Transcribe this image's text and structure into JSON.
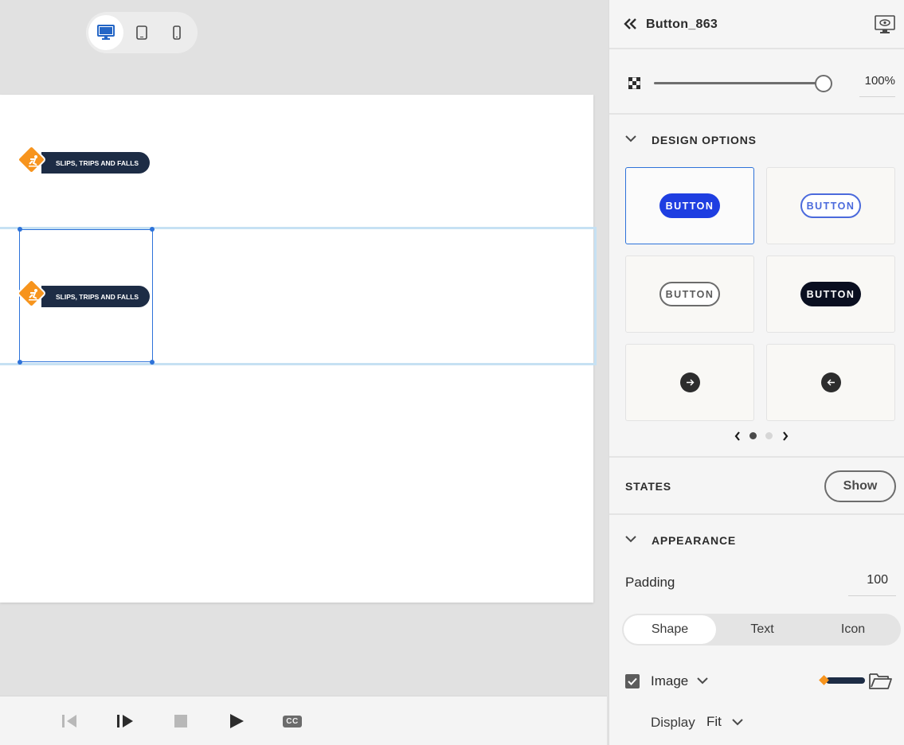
{
  "device_toggle": {
    "options": [
      "desktop-icon",
      "tablet-icon",
      "mobile-icon"
    ],
    "active": "desktop"
  },
  "canvas": {
    "tag_top_label": "SLIPS, TRIPS AND FALLS",
    "tag_selected_label": "SLIPS, TRIPS AND FALLS"
  },
  "playbar": {
    "icons": [
      "previous-icon",
      "step-play-icon",
      "stop-icon",
      "play-icon",
      "closed-captions-icon"
    ],
    "cc_label": "CC"
  },
  "panel": {
    "title": "Button_863",
    "opacity_value": "100%",
    "opacity_level": 1.0,
    "design_options": {
      "label": "DESIGN OPTIONS",
      "button_label": "BUTTON",
      "page_count": 2,
      "current_page": 1
    },
    "states": {
      "label": "STATES",
      "show_label": "Show"
    },
    "appearance": {
      "label": "APPEARANCE",
      "padding_label": "Padding",
      "padding_value": "100",
      "tabs": [
        "Shape",
        "Text",
        "Icon"
      ],
      "active_tab": "Shape",
      "image_label": "Image",
      "image_checked": true,
      "display_label": "Display",
      "display_value": "Fit"
    }
  },
  "colors": {
    "accent_blue": "#2d72d9",
    "button_blue": "#1e3ee1",
    "tag_navy": "#1d2c45",
    "tag_orange": "#f7941d"
  }
}
